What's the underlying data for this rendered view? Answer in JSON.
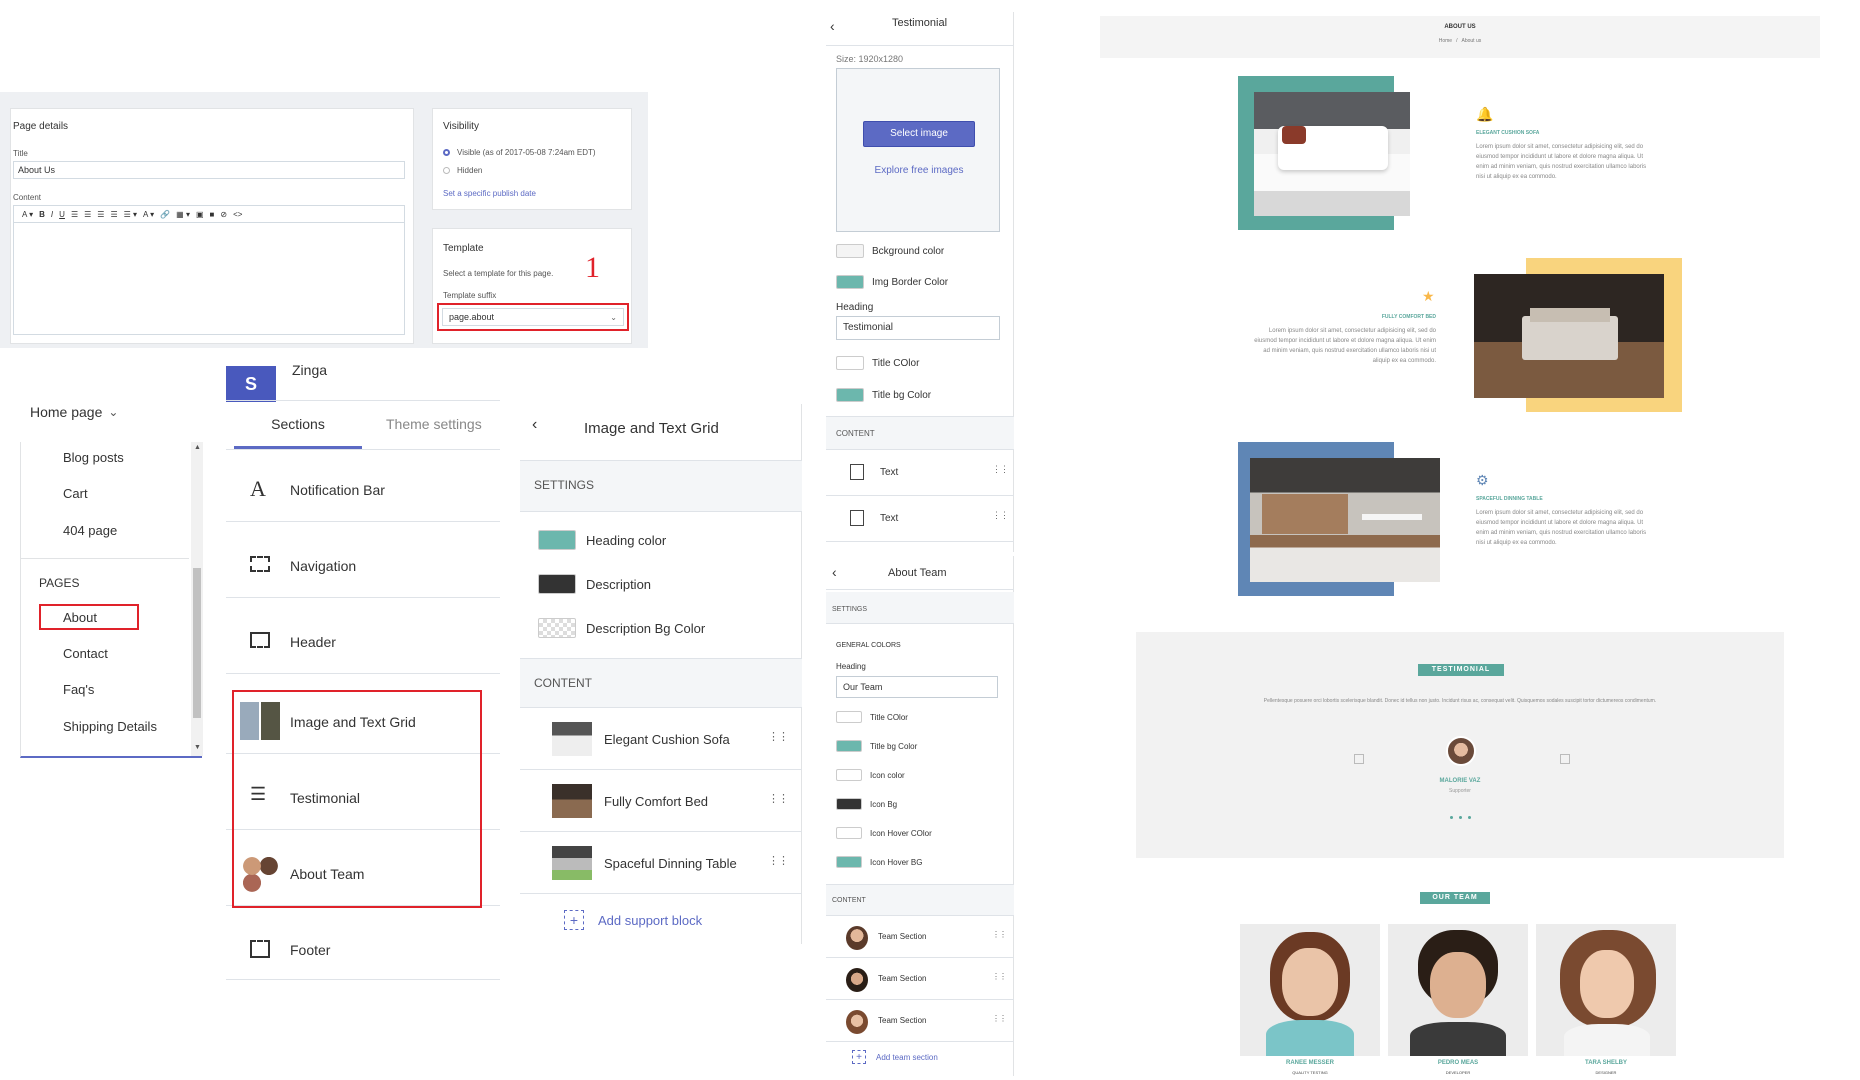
{
  "page_details": {
    "heading": "Page details",
    "title_label": "Title",
    "title_value": "About Us",
    "content_label": "Content",
    "toolbar": [
      "A ▾",
      "B",
      "I",
      "U",
      "☰",
      "☰",
      "☰",
      "☰",
      "☰ ▾",
      "A ▾",
      "🔗",
      "▦ ▾",
      "▣",
      "■",
      "⊘",
      "<>"
    ]
  },
  "visibility": {
    "heading": "Visibility",
    "visible_label": "Visible (as of 2017-05-08 7:24am EDT)",
    "hidden_label": "Hidden",
    "publish_link": "Set a specific publish date"
  },
  "template": {
    "heading": "Template",
    "description": "Select a template for this page.",
    "suffix_label": "Template suffix",
    "suffix_value": "page.about",
    "step_number": "1"
  },
  "nav_panel": {
    "dropdown_label": "Home page",
    "items_top": [
      "Blog posts",
      "Cart",
      "404 page"
    ],
    "pages_heading": "PAGES",
    "pages": [
      "About",
      "Contact",
      "Faq's",
      "Shipping Details"
    ]
  },
  "sections_panel": {
    "store_name": "Zinga",
    "tabs": [
      "Sections",
      "Theme settings"
    ],
    "items": [
      "Notification Bar",
      "Navigation",
      "Header",
      "Image and Text Grid",
      "Testimonial",
      "About Team",
      "Footer"
    ]
  },
  "grid_settings": {
    "title": "Image and Text Grid",
    "settings_heading": "SETTINGS",
    "settings": [
      {
        "label": "Heading color",
        "swatch": "#6cb7ad"
      },
      {
        "label": "Description",
        "swatch": "#333333"
      },
      {
        "label": "Description Bg Color",
        "swatch": "transparent"
      }
    ],
    "content_heading": "CONTENT",
    "blocks": [
      "Elegant Cushion Sofa",
      "Fully Comfort Bed",
      "Spaceful Dinning Table"
    ],
    "add_label": "Add support block"
  },
  "testimonial_settings": {
    "title": "Testimonial",
    "size_label": "Size: 1920x1280",
    "select_image": "Select image",
    "explore_link": "Explore free images",
    "bg_color_label": "Bckground color",
    "img_border_label": "Img Border Color",
    "heading_label": "Heading",
    "heading_value": "Testimonial",
    "title_color_label": "Title COlor",
    "title_bg_label": "Title bg Color",
    "content_heading": "CONTENT",
    "blocks": [
      "Text",
      "Text"
    ]
  },
  "team_settings": {
    "title": "About Team",
    "settings_heading": "SETTINGS",
    "general_colors": "GENERAL COLORS",
    "heading_label": "Heading",
    "heading_value": "Our Team",
    "colors": [
      {
        "label": "Title COlor",
        "swatch": "#ffffff"
      },
      {
        "label": "Title bg Color",
        "swatch": "#6cb7ad"
      },
      {
        "label": "Icon color",
        "swatch": "#ffffff"
      },
      {
        "label": "Icon Bg",
        "swatch": "#333333"
      },
      {
        "label": "Icon Hover COlor",
        "swatch": "#ffffff"
      },
      {
        "label": "Icon Hover BG",
        "swatch": "#6cb7ad"
      }
    ],
    "content_heading": "CONTENT",
    "blocks": [
      "Team Section",
      "Team Section",
      "Team Section"
    ],
    "add_label": "Add team section"
  },
  "preview": {
    "banner_title": "ABOUT US",
    "breadcrumb_home": "Home",
    "breadcrumb_sep": "/",
    "breadcrumb_current": "About us",
    "features": [
      {
        "title": "ELEGANT CUSHION SOFA",
        "border": "#5aa79c",
        "text": "Lorem ipsum dolor sit amet, consectetur adipisicing elit, sed do eiusmod tempor incididunt ut labore et dolore magna aliqua. Ut enim ad minim veniam, quis nostrud exercitation ullamco laboris nisi ut aliquip ex ea commodo."
      },
      {
        "title": "FULLY COMFORT BED",
        "border": "#f9d47e",
        "text": "Lorem ipsum dolor sit amet, consectetur adipisicing elit, sed do eiusmod tempor incididunt ut labore et dolore magna aliqua. Ut enim ad minim veniam, quis nostrud exercitation ullamco laboris nisi ut aliquip ex ea commodo."
      },
      {
        "title": "SPACEFUL DINNING TABLE",
        "border": "#5f86b5",
        "text": "Lorem ipsum dolor sit amet, consectetur adipisicing elit, sed do eiusmod tempor incididunt ut labore et dolore magna aliqua. Ut enim ad minim veniam, quis nostrud exercitation ullamco laboris nisi ut aliquip ex ea commodo."
      }
    ],
    "testimonial_heading": "TESTIMONIAL",
    "testimonial_text": "Pellentesque posuere orci lobortis scelerisque blandit. Donec id tellus non justo. Incidunt risus ac, consequat velit. Quisquemos sodales suscipit tortor dictumereos condimentum.",
    "testimonial_name": "MALORIE VAZ",
    "testimonial_role": "Supporter",
    "team_heading": "OUR TEAM",
    "team": [
      {
        "name": "RANEE MESSER",
        "role": "QUALITY TESTING"
      },
      {
        "name": "PEDRO MEAS",
        "role": "DEVELOPER"
      },
      {
        "name": "TARA SHELBY",
        "role": "DESIGNER"
      }
    ]
  }
}
